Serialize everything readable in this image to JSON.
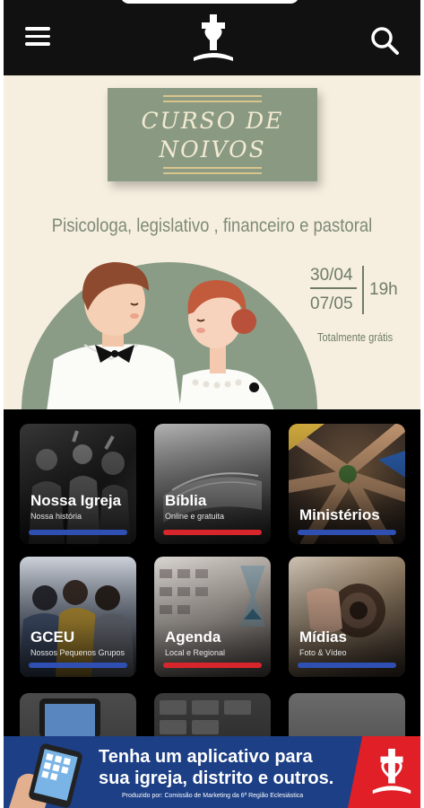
{
  "header": {
    "menu_icon": "hamburger-menu-icon",
    "logo_icon": "cross-church-logo-icon",
    "search_icon": "search-icon"
  },
  "banner": {
    "title_line1": "CURSO DE",
    "title_line2": "NOIVOS",
    "subtitle": "Pisicologa, legislativo , financeiro e pastoral",
    "date1": "30/04",
    "date2": "07/05",
    "time": "19h",
    "free": "Totalmente grátis"
  },
  "tiles": [
    {
      "label": "Nossa Igreja",
      "sub": "Nossa história",
      "bar_color": "#2f4fb3"
    },
    {
      "label": "Bíblia",
      "sub": "Online e gratuita",
      "bar_color": "#d6262c"
    },
    {
      "label": "Ministérios",
      "sub": "",
      "bar_color": "#2f4fb3"
    },
    {
      "label": "GCEU",
      "sub": "Nossos Pequenos Grupos",
      "bar_color": "#2f4fb3"
    },
    {
      "label": "Agenda",
      "sub": "Local e Regional",
      "bar_color": "#d6262c"
    },
    {
      "label": "Mídias",
      "sub": "Foto & Vídeo",
      "bar_color": "#2f4fb3"
    }
  ],
  "ad": {
    "line1": "Tenha um aplicativo para",
    "line2": "sua igreja, distrito e outros.",
    "credit": "Produzido por: Comissão de Marketing da 6ª Região Eclesiástica"
  }
}
